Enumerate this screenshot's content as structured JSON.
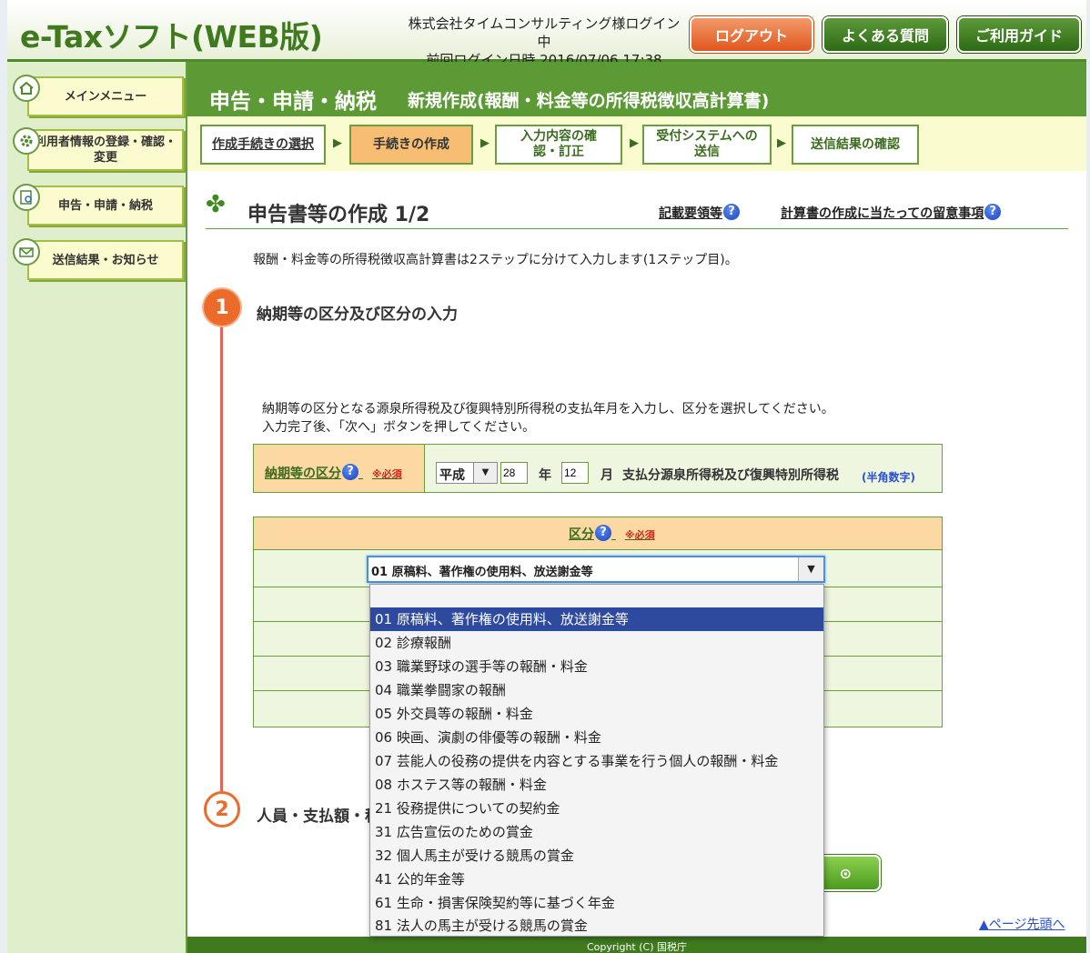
{
  "header": {
    "logo": "e-Taxソフト(WEB版)",
    "login_line1": "株式会社タイムコンサルティング様ログイン中",
    "login_line2": "前回ログイン日時 2016/07/06 17:38",
    "logout": "ログアウト",
    "faq": "よくある質問",
    "guide": "ご利用ガイド"
  },
  "sidebar": {
    "items": [
      {
        "label": "メインメニュー",
        "icon": "house-icon"
      },
      {
        "label": "利用者情報の登録・確認・変更",
        "icon": "gear-icon"
      },
      {
        "label": "申告・申請・納税",
        "icon": "magnifier-icon"
      },
      {
        "label": "送信結果・お知らせ",
        "icon": "envelope-icon"
      }
    ]
  },
  "main": {
    "title": "申告・申請・納税",
    "subtitle": "新規作成(報酬・料金等の所得税徴収高計算書)",
    "steps": [
      "作成手続きの選択",
      "手続きの作成",
      "入力内容の確認・訂正",
      "受付システムへの送信",
      "送信結果の確認"
    ],
    "section_title": "申告書等の作成 1/2",
    "help_link1": "記載要領等",
    "help_link2": "計算書の作成に当たっての留意事項",
    "intro": "報酬・料金等の所得税徴収高計算書は2ステップに分けて入力します(1ステップ目)。",
    "step1_num": "1",
    "step1_title": "納期等の区分及び区分の入力",
    "step2_num": "2",
    "step2_title": "人員・支払額・税",
    "instr_line1": "納期等の区分となる源泉所得税及び復興特別所得税の支払年月を入力し、区分を選択してください。",
    "instr_line2": "入力完了後、「次へ」ボタンを押してください。",
    "period_label": "納期等の区分",
    "required": "※必須",
    "era": "平成",
    "year": "28",
    "year_unit": "年",
    "month": "12",
    "month_unit": "月",
    "period_suffix": "支払分源泉所得税及び復興特別所得税",
    "half_width": "(半角数字)",
    "class_label": "区分",
    "class_value": "01 原稿料、著作権の使用料、放送謝金等",
    "page_top": "ページ先頭へ",
    "footer": "Copyright (C) 国税庁"
  },
  "dropdown": {
    "options": [
      "",
      "01 原稿料、著作権の使用料、放送謝金等",
      "02 診療報酬",
      "03 職業野球の選手等の報酬・料金",
      "04 職業拳闘家の報酬",
      "05 外交員等の報酬・料金",
      "06 映画、演劇の俳優等の報酬・料金",
      "07 芸能人の役務の提供を内容とする事業を行う個人の報酬・料金",
      "08 ホステス等の報酬・料金",
      "21 役務提供についての契約金",
      "31 広告宣伝のための賞金",
      "32 個人馬主が受ける競馬の賞金",
      "41 公的年金等",
      "61 生命・損害保険契約等に基づく年金",
      "81 法人の馬主が受ける競馬の賞金"
    ]
  }
}
